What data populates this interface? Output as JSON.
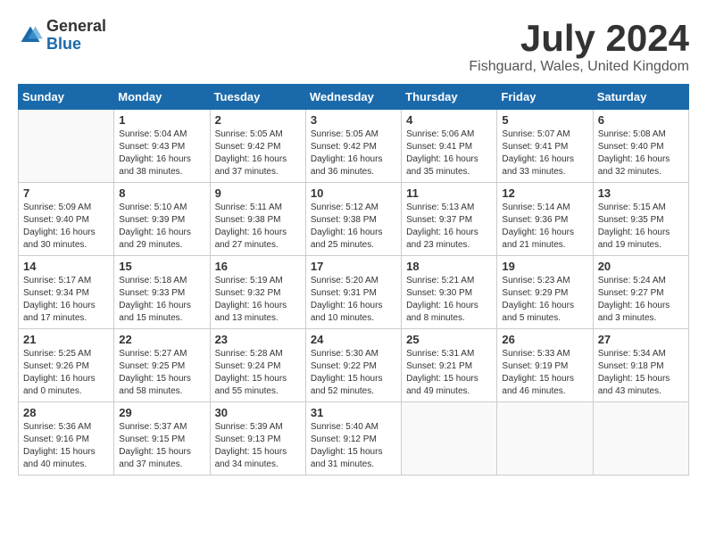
{
  "header": {
    "logo_general": "General",
    "logo_blue": "Blue",
    "month": "July 2024",
    "location": "Fishguard, Wales, United Kingdom"
  },
  "weekdays": [
    "Sunday",
    "Monday",
    "Tuesday",
    "Wednesday",
    "Thursday",
    "Friday",
    "Saturday"
  ],
  "weeks": [
    [
      {
        "day": "",
        "text": ""
      },
      {
        "day": "1",
        "text": "Sunrise: 5:04 AM\nSunset: 9:43 PM\nDaylight: 16 hours\nand 38 minutes."
      },
      {
        "day": "2",
        "text": "Sunrise: 5:05 AM\nSunset: 9:42 PM\nDaylight: 16 hours\nand 37 minutes."
      },
      {
        "day": "3",
        "text": "Sunrise: 5:05 AM\nSunset: 9:42 PM\nDaylight: 16 hours\nand 36 minutes."
      },
      {
        "day": "4",
        "text": "Sunrise: 5:06 AM\nSunset: 9:41 PM\nDaylight: 16 hours\nand 35 minutes."
      },
      {
        "day": "5",
        "text": "Sunrise: 5:07 AM\nSunset: 9:41 PM\nDaylight: 16 hours\nand 33 minutes."
      },
      {
        "day": "6",
        "text": "Sunrise: 5:08 AM\nSunset: 9:40 PM\nDaylight: 16 hours\nand 32 minutes."
      }
    ],
    [
      {
        "day": "7",
        "text": "Sunrise: 5:09 AM\nSunset: 9:40 PM\nDaylight: 16 hours\nand 30 minutes."
      },
      {
        "day": "8",
        "text": "Sunrise: 5:10 AM\nSunset: 9:39 PM\nDaylight: 16 hours\nand 29 minutes."
      },
      {
        "day": "9",
        "text": "Sunrise: 5:11 AM\nSunset: 9:38 PM\nDaylight: 16 hours\nand 27 minutes."
      },
      {
        "day": "10",
        "text": "Sunrise: 5:12 AM\nSunset: 9:38 PM\nDaylight: 16 hours\nand 25 minutes."
      },
      {
        "day": "11",
        "text": "Sunrise: 5:13 AM\nSunset: 9:37 PM\nDaylight: 16 hours\nand 23 minutes."
      },
      {
        "day": "12",
        "text": "Sunrise: 5:14 AM\nSunset: 9:36 PM\nDaylight: 16 hours\nand 21 minutes."
      },
      {
        "day": "13",
        "text": "Sunrise: 5:15 AM\nSunset: 9:35 PM\nDaylight: 16 hours\nand 19 minutes."
      }
    ],
    [
      {
        "day": "14",
        "text": "Sunrise: 5:17 AM\nSunset: 9:34 PM\nDaylight: 16 hours\nand 17 minutes."
      },
      {
        "day": "15",
        "text": "Sunrise: 5:18 AM\nSunset: 9:33 PM\nDaylight: 16 hours\nand 15 minutes."
      },
      {
        "day": "16",
        "text": "Sunrise: 5:19 AM\nSunset: 9:32 PM\nDaylight: 16 hours\nand 13 minutes."
      },
      {
        "day": "17",
        "text": "Sunrise: 5:20 AM\nSunset: 9:31 PM\nDaylight: 16 hours\nand 10 minutes."
      },
      {
        "day": "18",
        "text": "Sunrise: 5:21 AM\nSunset: 9:30 PM\nDaylight: 16 hours\nand 8 minutes."
      },
      {
        "day": "19",
        "text": "Sunrise: 5:23 AM\nSunset: 9:29 PM\nDaylight: 16 hours\nand 5 minutes."
      },
      {
        "day": "20",
        "text": "Sunrise: 5:24 AM\nSunset: 9:27 PM\nDaylight: 16 hours\nand 3 minutes."
      }
    ],
    [
      {
        "day": "21",
        "text": "Sunrise: 5:25 AM\nSunset: 9:26 PM\nDaylight: 16 hours\nand 0 minutes."
      },
      {
        "day": "22",
        "text": "Sunrise: 5:27 AM\nSunset: 9:25 PM\nDaylight: 15 hours\nand 58 minutes."
      },
      {
        "day": "23",
        "text": "Sunrise: 5:28 AM\nSunset: 9:24 PM\nDaylight: 15 hours\nand 55 minutes."
      },
      {
        "day": "24",
        "text": "Sunrise: 5:30 AM\nSunset: 9:22 PM\nDaylight: 15 hours\nand 52 minutes."
      },
      {
        "day": "25",
        "text": "Sunrise: 5:31 AM\nSunset: 9:21 PM\nDaylight: 15 hours\nand 49 minutes."
      },
      {
        "day": "26",
        "text": "Sunrise: 5:33 AM\nSunset: 9:19 PM\nDaylight: 15 hours\nand 46 minutes."
      },
      {
        "day": "27",
        "text": "Sunrise: 5:34 AM\nSunset: 9:18 PM\nDaylight: 15 hours\nand 43 minutes."
      }
    ],
    [
      {
        "day": "28",
        "text": "Sunrise: 5:36 AM\nSunset: 9:16 PM\nDaylight: 15 hours\nand 40 minutes."
      },
      {
        "day": "29",
        "text": "Sunrise: 5:37 AM\nSunset: 9:15 PM\nDaylight: 15 hours\nand 37 minutes."
      },
      {
        "day": "30",
        "text": "Sunrise: 5:39 AM\nSunset: 9:13 PM\nDaylight: 15 hours\nand 34 minutes."
      },
      {
        "day": "31",
        "text": "Sunrise: 5:40 AM\nSunset: 9:12 PM\nDaylight: 15 hours\nand 31 minutes."
      },
      {
        "day": "",
        "text": ""
      },
      {
        "day": "",
        "text": ""
      },
      {
        "day": "",
        "text": ""
      }
    ]
  ]
}
